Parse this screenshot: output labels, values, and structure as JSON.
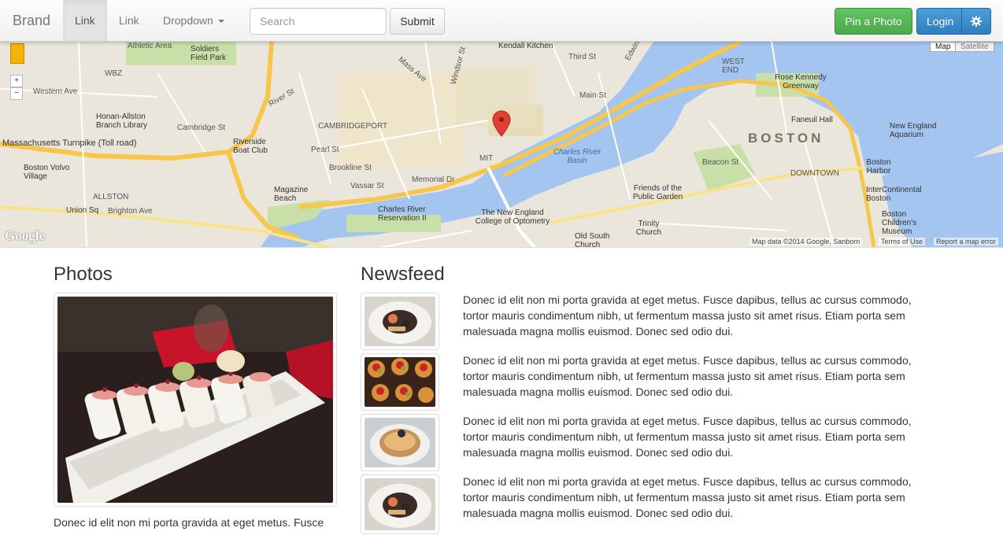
{
  "navbar": {
    "brand": "Brand",
    "links": [
      "Link",
      "Link"
    ],
    "dropdown_label": "Dropdown",
    "search_placeholder": "Search",
    "submit_label": "Submit",
    "pin_label": "Pin a Photo",
    "login_label": "Login",
    "settings_icon": "gear-icon"
  },
  "map": {
    "type_map": "Map",
    "type_satellite": "Satellite",
    "zoom_in": "+",
    "zoom_out": "−",
    "attribution": "Map data ©2014 Google, Sanborn",
    "terms": "Terms of Use",
    "report": "Report a map error",
    "google": "Google",
    "labels": [
      "Soldiers Field Park",
      "Athletic Area",
      "WBZ",
      "Western Ave",
      "Honan-Allston Branch Library",
      "Massachusetts Turnpike (Toll road)",
      "Boston Volvo Village",
      "ALLSTON",
      "Union Sq",
      "Brighton Ave",
      "Riverside Boat Club",
      "Cambridge St",
      "CAMBRIDGEPORT",
      "Magazine Beach",
      "Pearl St",
      "Brookline St",
      "Vassar St",
      "Memorial Dr",
      "Charles River Reservation II",
      "Kendall Kitchen",
      "Third St",
      "Main St",
      "MIT",
      "Charles River Basin",
      "The New England College of Optometry",
      "Old South Church",
      "Trinity Church",
      "Friends of the Public Garden",
      "Beacon St",
      "BOSTON",
      "DOWNTOWN",
      "Faneuil Hall",
      "Rose Kennedy Greenway",
      "WEST END",
      "New England Aquarium",
      "Boston Harbor",
      "InterContinental Boston",
      "Boston Children's Museum",
      "Mass Ave",
      "Windsor St",
      "River St",
      "Edwin"
    ]
  },
  "photos": {
    "title": "Photos",
    "caption": "Donec id elit non mi porta gravida at eget metus. Fusce"
  },
  "newsfeed": {
    "title": "Newsfeed",
    "items": [
      "Donec id elit non mi porta gravida at eget metus. Fusce dapibus, tellus ac cursus commodo, tortor mauris condimentum nibh, ut fermentum massa justo sit amet risus. Etiam porta sem malesuada magna mollis euismod. Donec sed odio dui.",
      "Donec id elit non mi porta gravida at eget metus. Fusce dapibus, tellus ac cursus commodo, tortor mauris condimentum nibh, ut fermentum massa justo sit amet risus. Etiam porta sem malesuada magna mollis euismod. Donec sed odio dui.",
      "Donec id elit non mi porta gravida at eget metus. Fusce dapibus, tellus ac cursus commodo, tortor mauris condimentum nibh, ut fermentum massa justo sit amet risus. Etiam porta sem malesuada magna mollis euismod. Donec sed odio dui.",
      "Donec id elit non mi porta gravida at eget metus. Fusce dapibus, tellus ac cursus commodo, tortor mauris condimentum nibh, ut fermentum massa justo sit amet risus. Etiam porta sem malesuada magna mollis euismod. Donec sed odio dui."
    ]
  },
  "colors": {
    "success": "#5cb85c",
    "primary": "#428bca",
    "water": "#a3c5f0",
    "park": "#c8dfa8",
    "highway": "#f6c74c"
  }
}
